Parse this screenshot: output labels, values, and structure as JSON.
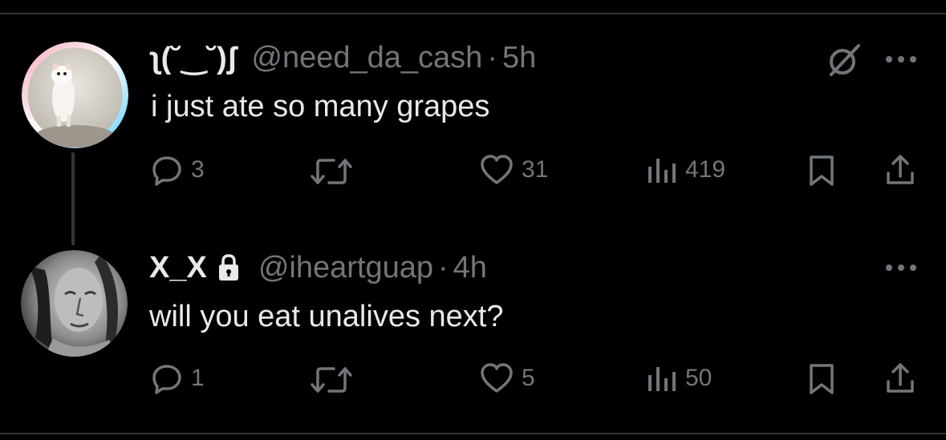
{
  "tweets": [
    {
      "display_name": "ʅ(˘‿˘)ʃ",
      "handle": "@need_da_cash",
      "separator": "·",
      "time": "5h",
      "text": "i just ate so many grapes",
      "replies": "3",
      "likes": "31",
      "views": "419"
    },
    {
      "display_name": "X_X",
      "handle": "@iheartguap",
      "separator": "·",
      "time": "4h",
      "text": "will you eat unalives next?",
      "replies": "1",
      "likes": "5",
      "views": "50"
    }
  ],
  "colors": {
    "background": "#000000",
    "text_primary": "#e7e9ea",
    "text_secondary": "#71767b",
    "divider": "#2f3336",
    "avatar_ring_pink": "#f5a9b8",
    "avatar_ring_blue": "#5bcefa"
  }
}
